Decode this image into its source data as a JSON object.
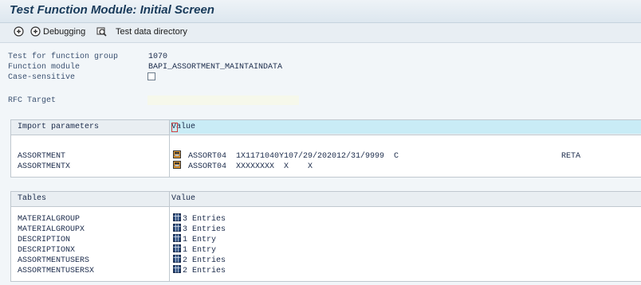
{
  "header": {
    "title": "Test Function Module: Initial Screen"
  },
  "toolbar": {
    "execute_icon": "execute-icon",
    "debugging_label": "Debugging",
    "test_data_label": "Test data directory"
  },
  "form": {
    "function_group_label": "Test for function group",
    "function_group_value": "1070",
    "function_module_label": "Function module",
    "function_module_value": "BAPI_ASSORTMENT_MAINTAINDATA",
    "case_sensitive_label": "Case-sensitive",
    "rfc_target_label": "RFC Target",
    "rfc_target_value": ""
  },
  "import_panel": {
    "col1": "Import parameters",
    "col2": "Value",
    "rows": [
      {
        "name": "ASSORTMENT",
        "value": "ASSORT04  1X1171040Y107/29/202012/31/9999  C",
        "extra": "RETA"
      },
      {
        "name": "ASSORTMENTX",
        "value": "ASSORT04  XXXXXXXX  X    X",
        "extra": ""
      }
    ]
  },
  "tables_panel": {
    "col1": "Tables",
    "col2": "Value",
    "rows": [
      {
        "name": "MATERIALGROUP",
        "value": "3 Entries"
      },
      {
        "name": "MATERIALGROUPX",
        "value": "3 Entries"
      },
      {
        "name": "DESCRIPTION",
        "value": "1 Entry"
      },
      {
        "name": "DESCRIPTIONX",
        "value": "1 Entry"
      },
      {
        "name": "ASSORTMENTUSERS",
        "value": "2 Entries"
      },
      {
        "name": "ASSORTMENTUSERSX",
        "value": "2 Entries"
      }
    ]
  }
}
